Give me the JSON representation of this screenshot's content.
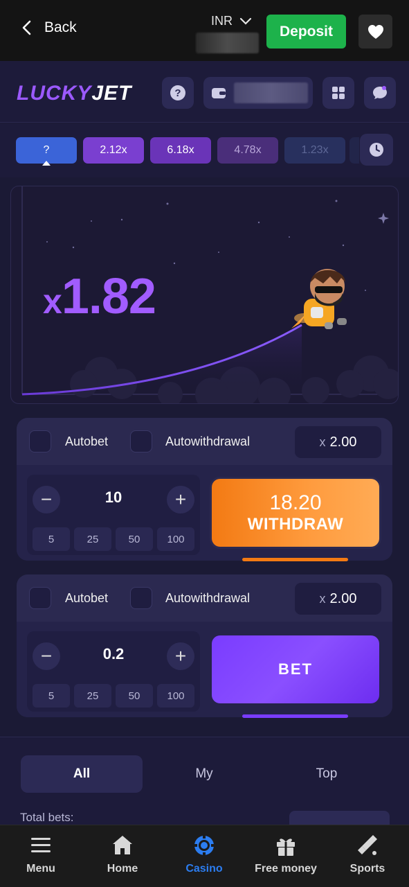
{
  "topbar": {
    "back_label": "Back",
    "currency": "INR",
    "deposit_label": "Deposit"
  },
  "game": {
    "logo_lucky": "LUCKY",
    "logo_jet": "JET",
    "history": [
      {
        "label": "?",
        "color": "#3b64d8"
      },
      {
        "label": "2.12x",
        "color": "#7a3fd0"
      },
      {
        "label": "6.18x",
        "color": "#6a34b8"
      },
      {
        "label": "4.78x",
        "color": "#4a2e7a"
      },
      {
        "label": "1.23x",
        "color": "#28305e"
      }
    ],
    "multiplier_prefix": "x",
    "multiplier_value": "1.82"
  },
  "bet_panels": [
    {
      "autobet_label": "Autobet",
      "autowithdrawal_label": "Autowithdrawal",
      "auto_mult_prefix": "x",
      "auto_mult_value": "2.00",
      "stake": "10",
      "quick_amounts": [
        "5",
        "25",
        "50",
        "100"
      ],
      "action_amount": "18.20",
      "action_label": "WITHDRAW",
      "action_color": "#f37a13"
    },
    {
      "autobet_label": "Autobet",
      "autowithdrawal_label": "Autowithdrawal",
      "auto_mult_prefix": "x",
      "auto_mult_value": "2.00",
      "stake": "0.2",
      "quick_amounts": [
        "5",
        "25",
        "50",
        "100"
      ],
      "action_label": "BET",
      "action_color": "#7a3cff"
    }
  ],
  "tabs": {
    "items": [
      {
        "label": "All",
        "active": true
      },
      {
        "label": "My",
        "active": false
      },
      {
        "label": "Top",
        "active": false
      }
    ],
    "total_bets_label": "Total bets:"
  },
  "bottomnav": {
    "items": [
      {
        "label": "Menu",
        "icon": "menu-icon"
      },
      {
        "label": "Home",
        "icon": "home-icon"
      },
      {
        "label": "Casino",
        "icon": "casino-chip-icon",
        "active": true
      },
      {
        "label": "Free money",
        "icon": "gift-icon"
      },
      {
        "label": "Sports",
        "icon": "sports-icon"
      }
    ],
    "active_color": "#2c7df0"
  }
}
